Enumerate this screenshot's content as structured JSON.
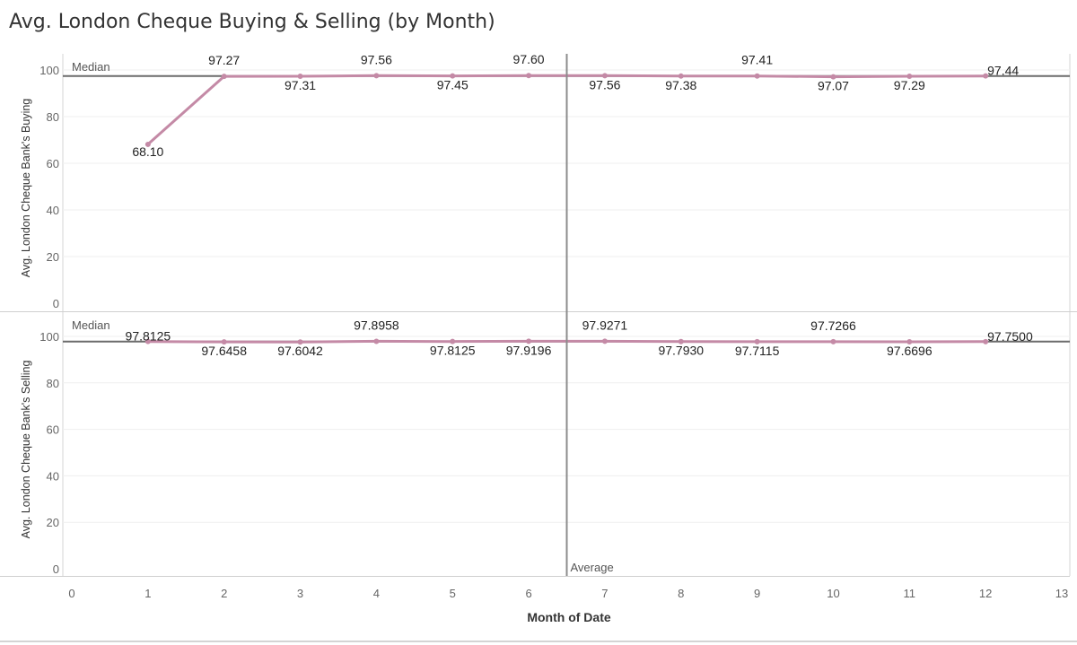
{
  "title": "Avg. London Cheque Buying & Selling (by Month)",
  "chart_data": {
    "type": "line",
    "xlabel": "Month of Date",
    "xlim": [
      0,
      13
    ],
    "x_ticks": [
      "0",
      "1",
      "2",
      "3",
      "4",
      "5",
      "6",
      "7",
      "8",
      "9",
      "10",
      "11",
      "12",
      "13"
    ],
    "x": [
      1,
      2,
      3,
      4,
      5,
      6,
      7,
      8,
      9,
      10,
      11,
      12
    ],
    "line_color": "#c48aa6",
    "panels": [
      {
        "ylabel": "Avg. London Cheque Bank's Buying",
        "ylim": [
          0,
          100
        ],
        "y_ticks": [
          "0",
          "20",
          "40",
          "60",
          "80",
          "100"
        ],
        "values": [
          68.1,
          97.27,
          97.31,
          97.56,
          97.45,
          97.6,
          97.56,
          97.38,
          97.41,
          97.07,
          97.29,
          97.44
        ],
        "labels": [
          "68.10",
          "97.27",
          "97.31",
          "97.56",
          "97.45",
          "97.60",
          "97.56",
          "97.38",
          "97.41",
          "97.07",
          "97.29",
          "97.44"
        ],
        "reference_line": {
          "label": "Median",
          "value": 97.42
        }
      },
      {
        "ylabel": "Avg. London Cheque Bank's Selling",
        "ylim": [
          0,
          100
        ],
        "y_ticks": [
          "0",
          "20",
          "40",
          "60",
          "80",
          "100"
        ],
        "values": [
          97.8125,
          97.6458,
          97.6042,
          97.8958,
          97.8125,
          97.9196,
          97.9271,
          97.793,
          97.7115,
          97.7266,
          97.6696,
          97.75
        ],
        "labels": [
          "97.8125",
          "97.6458",
          "97.6042",
          "97.8958",
          "97.8125",
          "97.9196",
          "97.9271",
          "97.7930",
          "97.7115",
          "97.7266",
          "97.6696",
          "97.7500"
        ],
        "reference_line": {
          "label": "Median",
          "value": 97.78
        }
      }
    ],
    "vertical_reference": {
      "label": "Average",
      "value": 6.5
    },
    "grid": true
  }
}
